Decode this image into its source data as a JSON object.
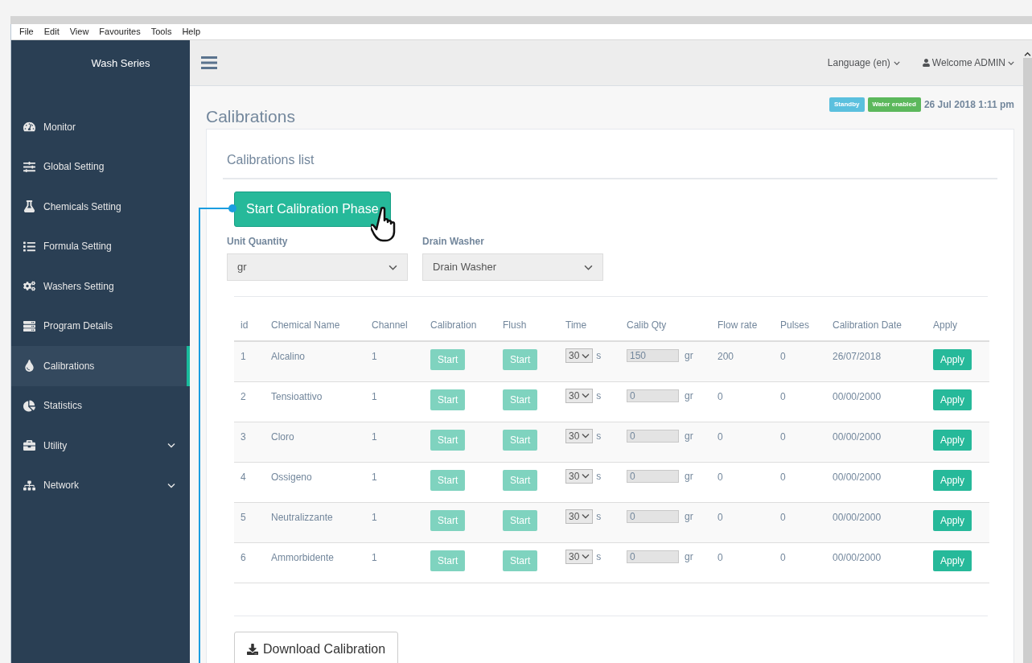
{
  "menu_bar": [
    "File",
    "Edit",
    "View",
    "Favourites",
    "Tools",
    "Help"
  ],
  "sidebar": {
    "title": "Wash Series",
    "items": [
      {
        "label": "Monitor",
        "selected": false,
        "has_submenu": false
      },
      {
        "label": "Global Setting",
        "selected": false,
        "has_submenu": false
      },
      {
        "label": "Chemicals Setting",
        "selected": false,
        "has_submenu": false
      },
      {
        "label": "Formula Setting",
        "selected": false,
        "has_submenu": false
      },
      {
        "label": "Washers Setting",
        "selected": false,
        "has_submenu": false
      },
      {
        "label": "Program Details",
        "selected": false,
        "has_submenu": false
      },
      {
        "label": "Calibrations",
        "selected": true,
        "has_submenu": false
      },
      {
        "label": "Statistics",
        "selected": false,
        "has_submenu": false
      },
      {
        "label": "Utility",
        "selected": false,
        "has_submenu": true
      },
      {
        "label": "Network",
        "selected": false,
        "has_submenu": true
      }
    ]
  },
  "top_bar": {
    "language": "Language (en)",
    "user": "Welcome ADMIN"
  },
  "page": {
    "title": "Calibrations",
    "badges": [
      {
        "label": "Standby",
        "color": "#5bc0de"
      },
      {
        "label": "Water enabled",
        "color": "#5cb85c"
      }
    ],
    "datetime": "26 Jul 2018 1:11 pm"
  },
  "panel": {
    "title": "Calibrations list",
    "start_button": "Start Calibration Phase",
    "unit_quantity": {
      "label": "Unit Quantity",
      "value": "gr"
    },
    "drain_washer": {
      "label": "Drain Washer",
      "value": "Drain Washer"
    },
    "table": {
      "columns": [
        "id",
        "Chemical Name",
        "Channel",
        "Calibration",
        "Flush",
        "Time",
        "Calib Qty",
        "Flow rate",
        "Pulses",
        "Calibration Date",
        "Apply"
      ],
      "rows": [
        {
          "id": "1",
          "name": "Alcalino",
          "channel": "1",
          "calibration": {
            "label": "Start",
            "disabled": true
          },
          "flush": {
            "label": "Start",
            "disabled": true
          },
          "time": "30",
          "time_unit": "s",
          "qty": "150",
          "qty_unit": "gr",
          "flow_rate": "200",
          "pulses": "0",
          "date": "26/07/2018",
          "apply": {
            "label": "Apply",
            "disabled": false
          }
        },
        {
          "id": "2",
          "name": "Tensioattivo",
          "channel": "1",
          "calibration": {
            "label": "Start",
            "disabled": true
          },
          "flush": {
            "label": "Start",
            "disabled": true
          },
          "time": "30",
          "time_unit": "s",
          "qty": "0",
          "qty_unit": "gr",
          "flow_rate": "0",
          "pulses": "0",
          "date": "00/00/2000",
          "apply": {
            "label": "Apply",
            "disabled": false
          }
        },
        {
          "id": "3",
          "name": "Cloro",
          "channel": "1",
          "calibration": {
            "label": "Start",
            "disabled": true
          },
          "flush": {
            "label": "Start",
            "disabled": true
          },
          "time": "30",
          "time_unit": "s",
          "qty": "0",
          "qty_unit": "gr",
          "flow_rate": "0",
          "pulses": "0",
          "date": "00/00/2000",
          "apply": {
            "label": "Apply",
            "disabled": false
          }
        },
        {
          "id": "4",
          "name": "Ossigeno",
          "channel": "1",
          "calibration": {
            "label": "Start",
            "disabled": true
          },
          "flush": {
            "label": "Start",
            "disabled": true
          },
          "time": "30",
          "time_unit": "s",
          "qty": "0",
          "qty_unit": "gr",
          "flow_rate": "0",
          "pulses": "0",
          "date": "00/00/2000",
          "apply": {
            "label": "Apply",
            "disabled": false
          }
        },
        {
          "id": "5",
          "name": "Neutralizzante",
          "channel": "1",
          "calibration": {
            "label": "Start",
            "disabled": true
          },
          "flush": {
            "label": "Start",
            "disabled": true
          },
          "time": "30",
          "time_unit": "s",
          "qty": "0",
          "qty_unit": "gr",
          "flow_rate": "0",
          "pulses": "0",
          "date": "00/00/2000",
          "apply": {
            "label": "Apply",
            "disabled": false
          }
        },
        {
          "id": "6",
          "name": "Ammorbidente",
          "channel": "1",
          "calibration": {
            "label": "Start",
            "disabled": true
          },
          "flush": {
            "label": "Start",
            "disabled": true
          },
          "time": "30",
          "time_unit": "s",
          "qty": "0",
          "qty_unit": "gr",
          "flow_rate": "0",
          "pulses": "0",
          "date": "00/00/2000",
          "apply": {
            "label": "Apply",
            "disabled": false
          }
        }
      ]
    },
    "download_button": "Download Calibration"
  }
}
